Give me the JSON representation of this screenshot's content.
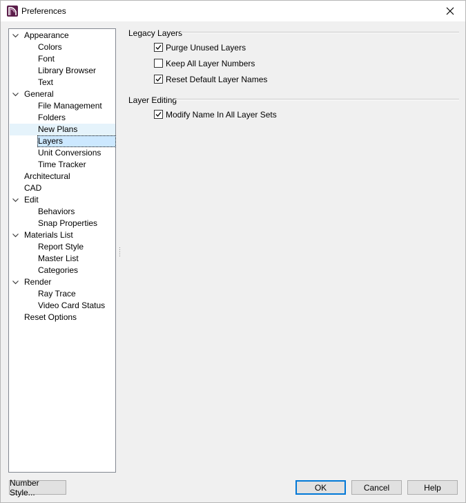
{
  "window": {
    "title": "Preferences"
  },
  "tree": {
    "items": [
      {
        "label": "Appearance",
        "level": 0,
        "expanded": true
      },
      {
        "label": "Colors",
        "level": 1
      },
      {
        "label": "Font",
        "level": 1
      },
      {
        "label": "Library Browser",
        "level": 1
      },
      {
        "label": "Text",
        "level": 1
      },
      {
        "label": "General",
        "level": 0,
        "expanded": true
      },
      {
        "label": "File Management",
        "level": 1
      },
      {
        "label": "Folders",
        "level": 1
      },
      {
        "label": "New Plans",
        "level": 1,
        "hover": true
      },
      {
        "label": "Layers",
        "level": 1,
        "selected": true
      },
      {
        "label": "Unit Conversions",
        "level": 1
      },
      {
        "label": "Time Tracker",
        "level": 1
      },
      {
        "label": "Architectural",
        "level": 0
      },
      {
        "label": "CAD",
        "level": 0
      },
      {
        "label": "Edit",
        "level": 0,
        "expanded": true
      },
      {
        "label": "Behaviors",
        "level": 1
      },
      {
        "label": "Snap Properties",
        "level": 1
      },
      {
        "label": "Materials List",
        "level": 0,
        "expanded": true
      },
      {
        "label": "Report Style",
        "level": 1
      },
      {
        "label": "Master List",
        "level": 1
      },
      {
        "label": "Categories",
        "level": 1
      },
      {
        "label": "Render",
        "level": 0,
        "expanded": true
      },
      {
        "label": "Ray Trace",
        "level": 1
      },
      {
        "label": "Video Card Status",
        "level": 1
      },
      {
        "label": "Reset Options",
        "level": 0
      }
    ]
  },
  "legacy_layers": {
    "heading": "Legacy Layers",
    "options": [
      {
        "label": "Purge Unused Layers",
        "checked": true
      },
      {
        "label": "Keep All Layer Numbers",
        "checked": false
      },
      {
        "label": "Reset Default Layer Names",
        "checked": true
      }
    ]
  },
  "layer_editing": {
    "heading": "Layer Editing",
    "options": [
      {
        "label": "Modify Name In All Layer Sets",
        "checked": true
      }
    ]
  },
  "buttons": {
    "number_style": "Number Style...",
    "ok": "OK",
    "cancel": "Cancel",
    "help": "Help"
  },
  "colors": {
    "app_icon": "#5b1d4a",
    "selection": "#cce8ff",
    "hover": "#e5f3fb",
    "default_button_border": "#0078d7"
  },
  "icons": {
    "app": "chief-architect-logo-icon",
    "close": "close-icon",
    "expand": "chevron-down-icon",
    "check": "checkmark-icon"
  }
}
